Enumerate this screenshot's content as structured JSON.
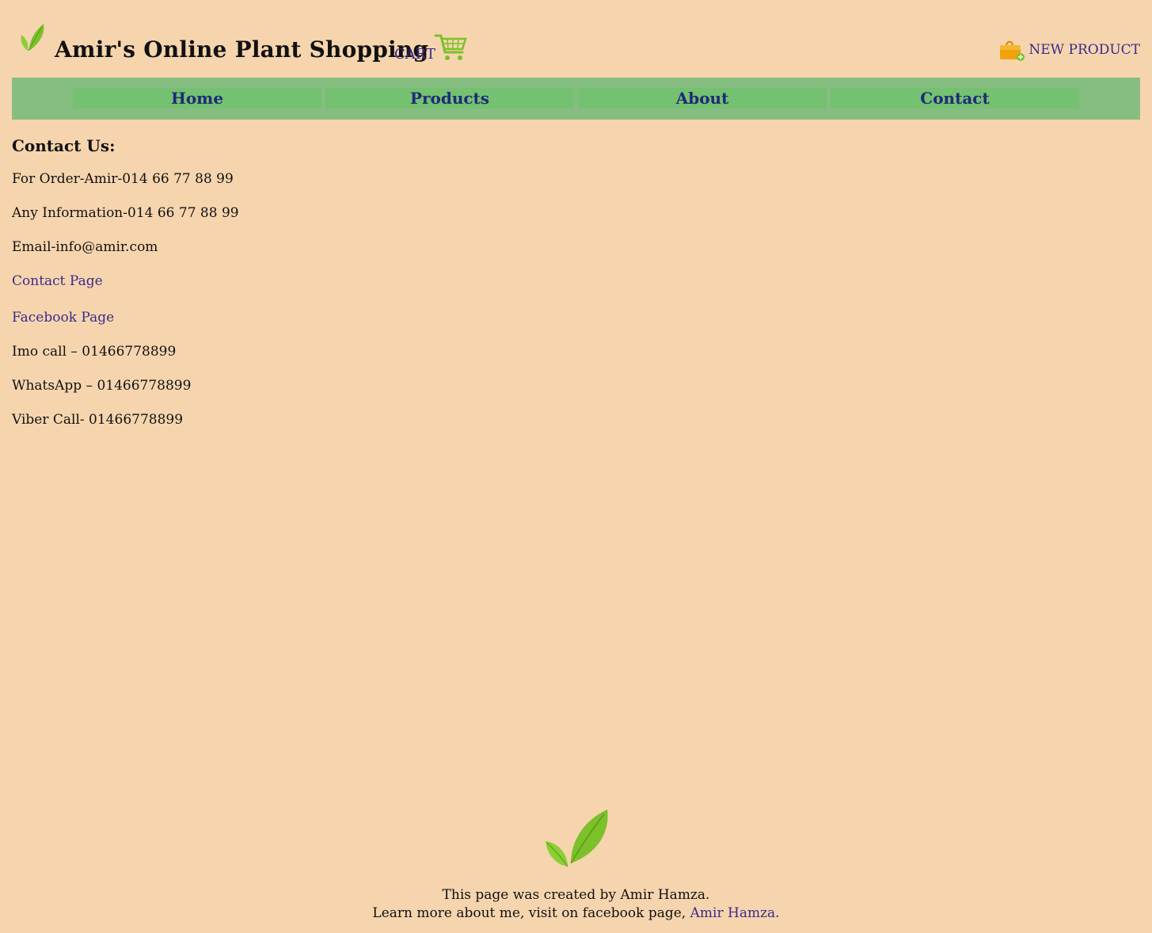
{
  "header": {
    "title": "Amir's Online Plant Shopping",
    "cart_label": "CART",
    "new_product_label": "NEW PRODUCT",
    "icons": [
      "leaf-logo-icon",
      "shopping-cart-icon",
      "shopping-bag-icon"
    ]
  },
  "nav": {
    "items": [
      {
        "label": "Home"
      },
      {
        "label": "Products"
      },
      {
        "label": "About"
      },
      {
        "label": "Contact"
      }
    ]
  },
  "content": {
    "title": "Contact Us:",
    "order": "For Order-Amir-014 66 77 88 99",
    "info": "Any Information-014 66 77 88 99",
    "email": "Email-info@amir.com",
    "contact_page": "Contact Page",
    "facebook_page": "Facebook Page",
    "imo": "Imo call – 01466778899",
    "whatsapp": "WhatsApp – 01466778899",
    "viber": "Viber Call- 01466778899"
  },
  "footer": {
    "created_by": "This page was created by Amir Hamza.",
    "learn_more": "Learn more about me, visit on facebook page, ",
    "author_link": "Amir Hamza."
  },
  "colors": {
    "background": "#f6d5ae",
    "nav_bar": "#86bd81",
    "nav_item": "#74c171",
    "nav_text": "#1f2a78",
    "link": "#3a2a8a",
    "leaf_green": "#7cc02a"
  }
}
